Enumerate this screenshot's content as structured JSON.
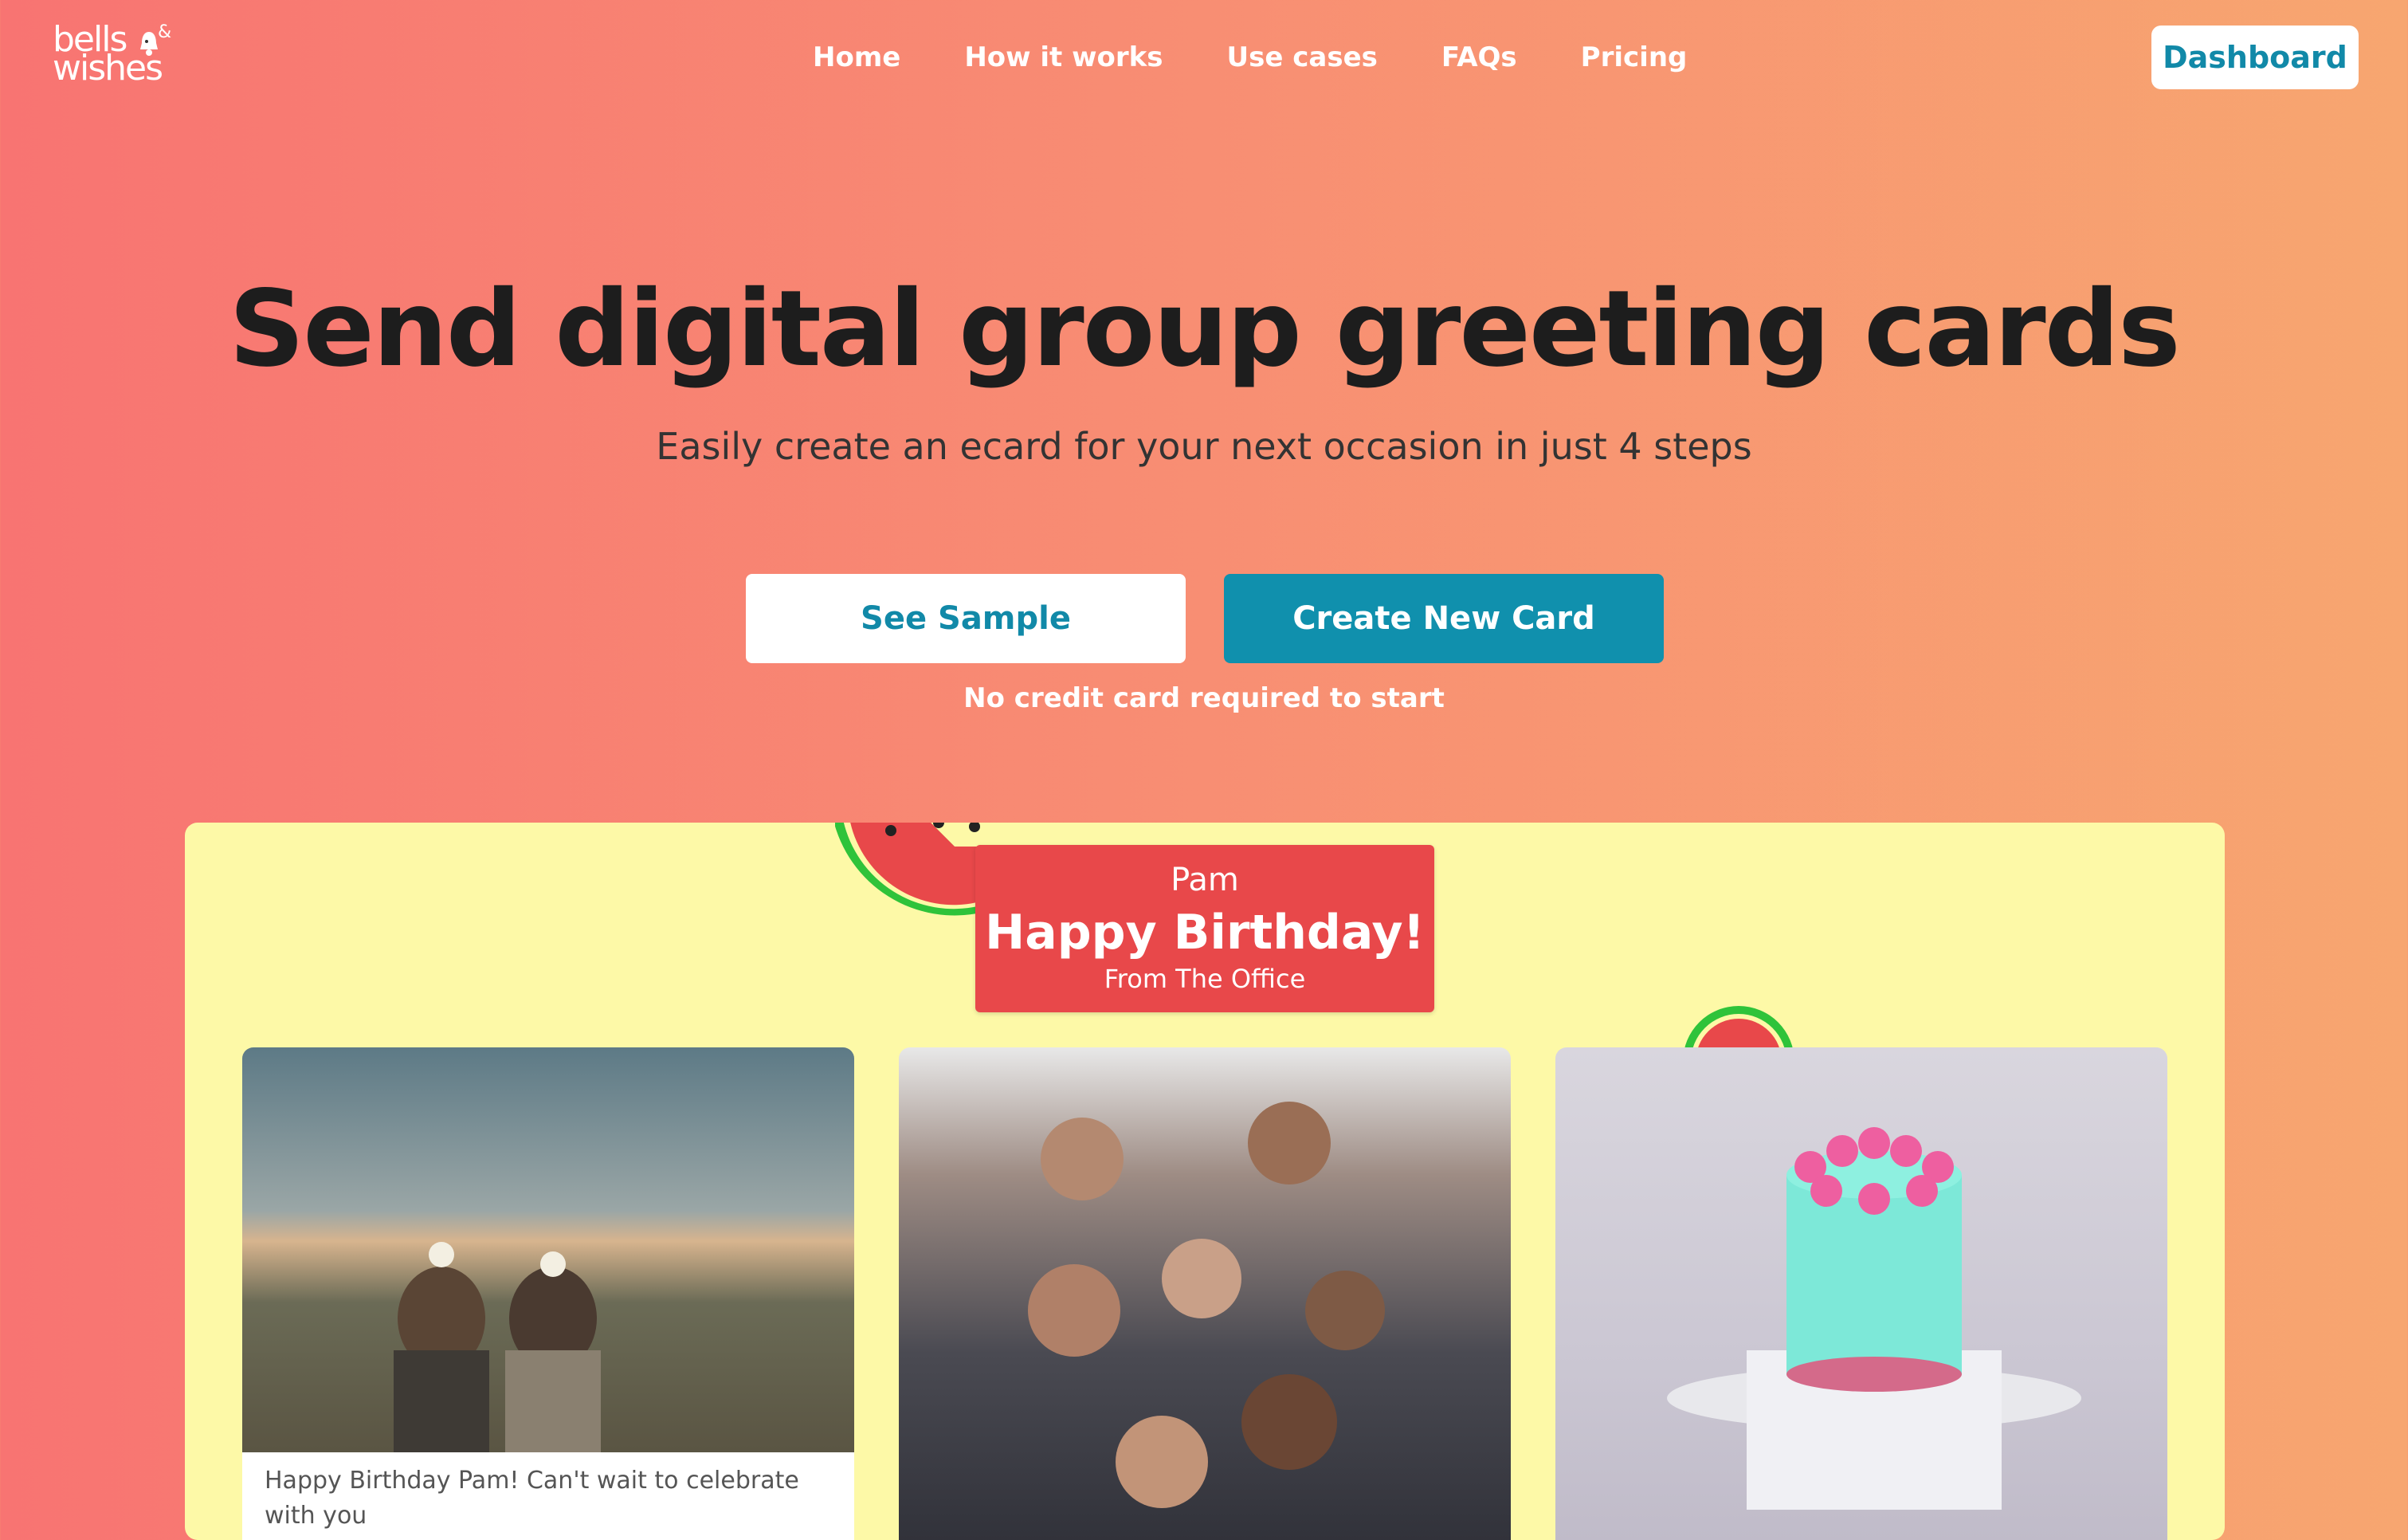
{
  "brand": {
    "logo_line1": "bells",
    "logo_line2": "wishes",
    "logo_amp": "&"
  },
  "nav": {
    "items": [
      {
        "label": "Home"
      },
      {
        "label": "How it works"
      },
      {
        "label": "Use cases"
      },
      {
        "label": "FAQs"
      },
      {
        "label": "Pricing"
      }
    ],
    "dashboard_label": "Dashboard"
  },
  "hero": {
    "title": "Send digital group greeting cards",
    "subtitle": "Easily create an ecard for your next occasion in just 4 steps",
    "see_sample_label": "See Sample",
    "create_label": "Create New Card",
    "note": "No credit card required to start"
  },
  "preview": {
    "banner_name": "Pam",
    "banner_title": "Happy Birthday!",
    "banner_from": "From The Office",
    "caption": "Happy Birthday Pam! Can't wait to celebrate with you"
  },
  "colors": {
    "gradient_left": "#f87472",
    "gradient_right": "#f7a670",
    "accent": "#1090ad",
    "board_bg": "#fdf9a7",
    "banner": "#e8484a"
  }
}
